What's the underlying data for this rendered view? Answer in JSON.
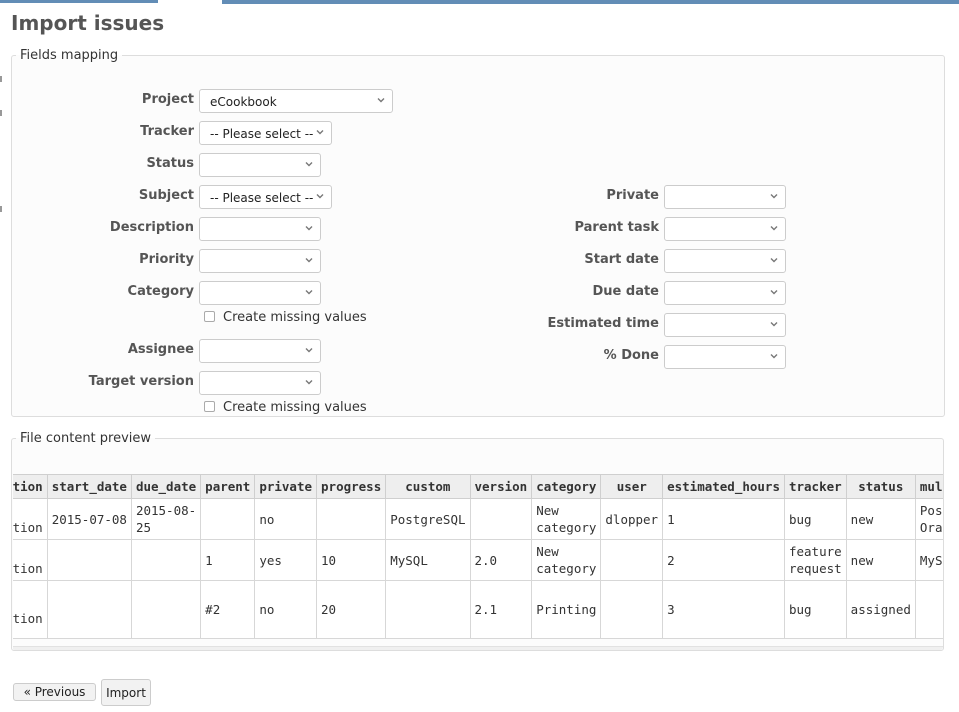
{
  "page": {
    "title": "Import issues"
  },
  "mapping": {
    "legend": "Fields mapping",
    "left_fields": [
      {
        "label": "Project",
        "value": "eCookbook"
      },
      {
        "label": "Tracker",
        "value": "-- Please select --"
      },
      {
        "label": "Status",
        "value": ""
      },
      {
        "label": "Subject",
        "value": "-- Please select --"
      },
      {
        "label": "Description",
        "value": ""
      },
      {
        "label": "Priority",
        "value": ""
      },
      {
        "label": "Category",
        "value": ""
      },
      {
        "label": "Assignee",
        "value": ""
      },
      {
        "label": "Target version",
        "value": ""
      }
    ],
    "right_fields": [
      {
        "label": "Private",
        "value": ""
      },
      {
        "label": "Parent task",
        "value": ""
      },
      {
        "label": "Start date",
        "value": ""
      },
      {
        "label": "Due date",
        "value": ""
      },
      {
        "label": "Estimated time",
        "value": ""
      },
      {
        "label": "% Done",
        "value": ""
      }
    ],
    "create_missing_category_label": "Create missing values",
    "create_missing_version_label": "Create missing values",
    "create_missing_category_checked": false,
    "create_missing_version_checked": false
  },
  "preview": {
    "legend": "File content preview",
    "columns": [
      "ription",
      "start_date",
      "due_date",
      "parent",
      "private",
      "progress",
      "custom",
      "version",
      "category",
      "user",
      "estimated_hours",
      "tracker",
      "status",
      "mul"
    ],
    "rows": [
      [
        "t\nription",
        "2015-07-08",
        "2015-08-25",
        "",
        "no",
        "",
        "PostgreSQL",
        "",
        "New\ncategory",
        "dlopper",
        "1",
        "bug",
        "new",
        "Pos\nOra"
      ],
      [
        "d\nription",
        "",
        "",
        "1",
        "yes",
        "10",
        "MySQL",
        "2.0",
        "New\ncategory",
        "",
        "2",
        "feature\nrequest",
        "new",
        "MyS"
      ],
      [
        "d\nription",
        "",
        "",
        "#2",
        "no",
        "20",
        "",
        "2.1",
        "Printing",
        "",
        "3",
        "bug",
        "assigned",
        ""
      ]
    ],
    "scroll_position": 0.19
  },
  "buttons": {
    "previous": "« Previous",
    "import": "Import"
  },
  "icons": {
    "select_arrow": "chevron-down-icon",
    "checkbox": "checkbox-icon"
  },
  "colors": {
    "accent": "#628db6",
    "fieldset_bg": "#fcfcfc",
    "header_bg": "#eeeeee"
  }
}
